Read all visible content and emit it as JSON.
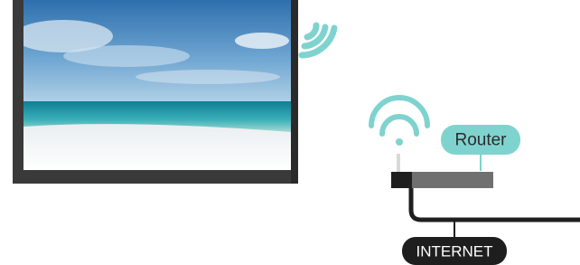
{
  "diagram": {
    "router_label": "Router",
    "internet_label": "INTERNET"
  },
  "colors": {
    "accent": "#7fd3cf",
    "tv_frame": "#3a3a3a",
    "router_body": "#707070",
    "router_front": "#1f1f1f",
    "cable": "#1f1f1f",
    "internet_pill": "#1e1e1e",
    "internet_text": "#ffffff",
    "router_text": "#2b2b2b"
  },
  "icons": [
    "tv-wifi-waves-icon",
    "router-wifi-icon"
  ]
}
